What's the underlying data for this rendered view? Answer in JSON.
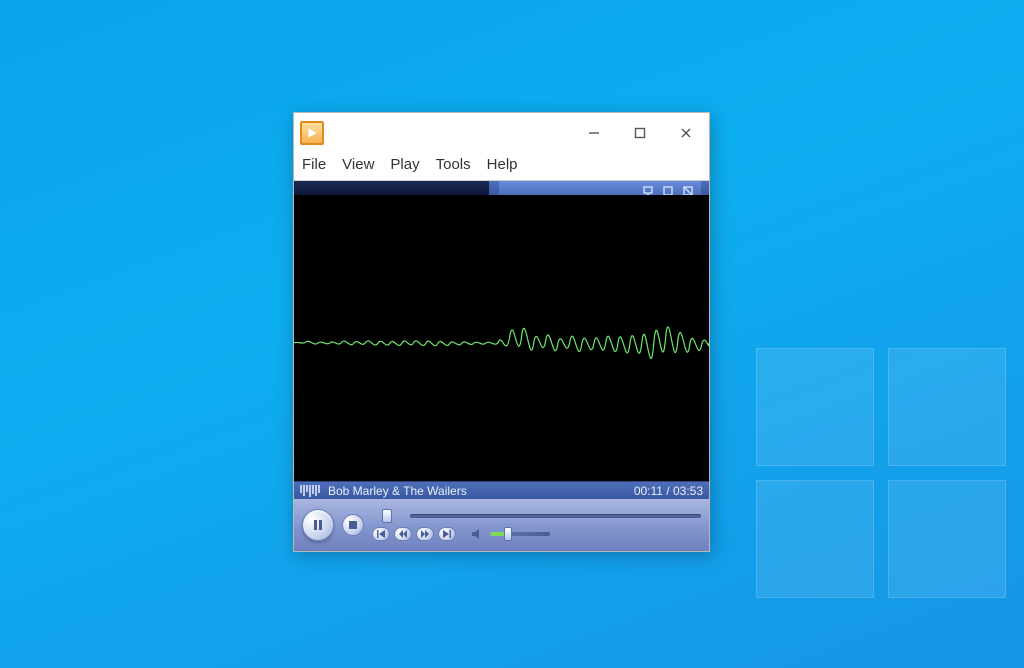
{
  "window": {
    "menus": {
      "file": "File",
      "view": "View",
      "play": "Play",
      "tools": "Tools",
      "help": "Help"
    }
  },
  "playback": {
    "track_artist": "Bob Marley & The Wailers",
    "elapsed": "00:11",
    "duration": "03:53",
    "time_display": "00:11 / 03:53"
  },
  "colors": {
    "waveform": "#6fe66f",
    "chrome": "#4b6fba"
  }
}
